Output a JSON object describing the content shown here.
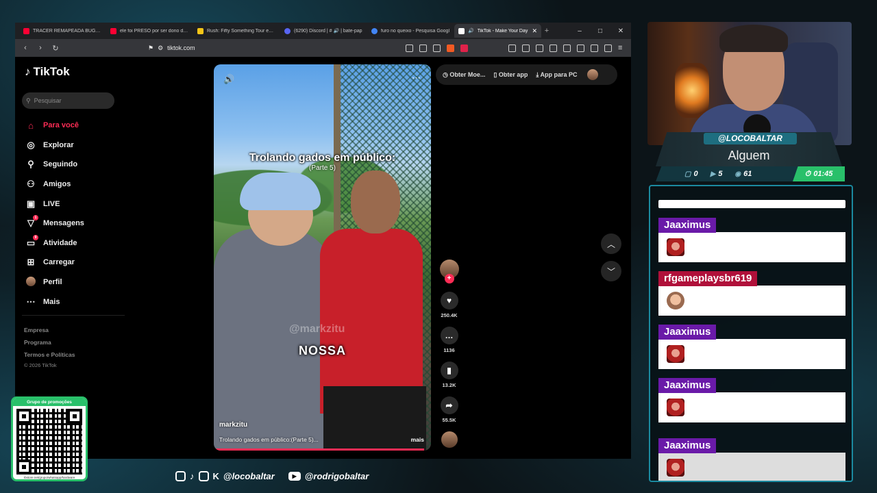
{
  "browser": {
    "tabs": [
      {
        "title": "TRACER REMAPEADA BUGANDO",
        "favicon_color": "#ff0033",
        "active": false
      },
      {
        "title": "ele foi PRESO por ser dono de u",
        "favicon_color": "#ff0033",
        "active": false
      },
      {
        "title": "Rush: Fifty Something Tour em 2",
        "favicon_color": "#f5c518",
        "active": false
      },
      {
        "title": "(6290) Discord | # 🔊 | bate-pap",
        "favicon_color": "#5865f2",
        "active": false
      },
      {
        "title": "furo no queixo - Pesquisa Googl",
        "favicon_color": "#4285f4",
        "active": false
      },
      {
        "title": "TikTok - Make Your Day",
        "favicon_color": "#ffffff",
        "active": true
      }
    ],
    "new_tab": "+",
    "window_controls": [
      "–",
      "□",
      "✕"
    ],
    "url": "tiktok.com"
  },
  "tiktok": {
    "logo": "TikTok",
    "search_placeholder": "Pesquisar",
    "nav": [
      {
        "label": "Para você",
        "icon": "home-icon",
        "glyph": "⌂",
        "active": true,
        "badge": ""
      },
      {
        "label": "Explorar",
        "icon": "compass-icon",
        "glyph": "◎",
        "active": false,
        "badge": ""
      },
      {
        "label": "Seguindo",
        "icon": "following-icon",
        "glyph": "⚲",
        "active": false,
        "badge": ""
      },
      {
        "label": "Amigos",
        "icon": "friends-icon",
        "glyph": "⚇",
        "active": false,
        "badge": ""
      },
      {
        "label": "LIVE",
        "icon": "live-icon",
        "glyph": "▣",
        "active": false,
        "badge": ""
      },
      {
        "label": "Mensagens",
        "icon": "messages-icon",
        "glyph": "▽",
        "active": false,
        "badge": "1"
      },
      {
        "label": "Atividade",
        "icon": "activity-icon",
        "glyph": "▭",
        "active": false,
        "badge": "9"
      },
      {
        "label": "Carregar",
        "icon": "upload-icon",
        "glyph": "⊞",
        "active": false,
        "badge": ""
      },
      {
        "label": "Perfil",
        "icon": "profile-icon",
        "glyph": "",
        "active": false,
        "badge": ""
      },
      {
        "label": "Mais",
        "icon": "more-icon",
        "glyph": "⋯",
        "active": false,
        "badge": ""
      }
    ],
    "footer": {
      "links": [
        "Empresa",
        "Programa",
        "Termos e Políticas"
      ],
      "copyright": "© 2026 TikTok"
    },
    "top_actions": {
      "coins": "Obter Moe...",
      "get_app": "Obter app",
      "pc_app": "App para PC"
    },
    "video": {
      "title_overlay": "Trolando gados em público:",
      "subtitle_overlay": "(Parte 5)",
      "watermark": "@markzitu",
      "caption": "NOSSA",
      "username": "markzitu",
      "description": "Trolando gados em público:(Parte 5)...",
      "more": "mais",
      "progress": 0.97
    },
    "stats": {
      "likes": "250.4K",
      "comments": "1136",
      "saves": "13.2K",
      "shares": "55.5K"
    }
  },
  "stream": {
    "handle": "@LOCOBALTAR",
    "game": "Alguem",
    "stats": [
      {
        "icon": "chat-icon",
        "value": "0"
      },
      {
        "icon": "youtube-icon",
        "value": "5"
      },
      {
        "icon": "viewers-icon",
        "value": "61"
      }
    ],
    "timer": "01:45",
    "qr_header": "Grupo de promoções",
    "qr_footer": "rbstore.net/grupo/whatsapp/hardware",
    "socials_handle": "@locobaltar",
    "youtube_handle": "@rodrigobaltar"
  },
  "chat": {
    "messages": [
      {
        "user": "Jaaximus",
        "user_color": "#6a1aa8",
        "emote": "angry"
      },
      {
        "user": "rfgameplaysbr619",
        "user_color": "#b0103a",
        "emote": "face"
      },
      {
        "user": "Jaaximus",
        "user_color": "#6a1aa8",
        "emote": "angry"
      },
      {
        "user": "Jaaximus",
        "user_color": "#6a1aa8",
        "emote": "angry"
      },
      {
        "user": "Jaaximus",
        "user_color": "#6a1aa8",
        "emote": "angry"
      }
    ]
  }
}
